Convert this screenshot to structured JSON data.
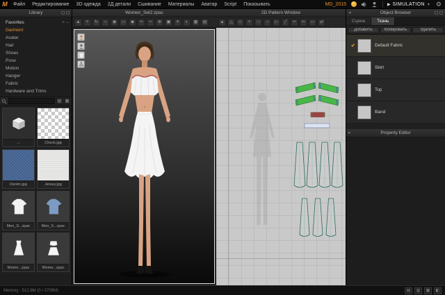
{
  "app": {
    "logo_letter": "M",
    "accent_color": "#e8912d"
  },
  "menubar": {
    "items": [
      "Файл",
      "Редактирование",
      "3D одежда",
      "2Д детали",
      "Сшивание",
      "Материалы",
      "Аватар",
      "Script",
      "Показывать"
    ],
    "version_label": "MD_2015",
    "simulation_label": "SIMULATION"
  },
  "icon_glyphs": {
    "select": "▲",
    "move": "+",
    "rotate": "↻",
    "zoom": "○",
    "show-avatar": "◉",
    "tape-measure": "▭",
    "pin": "◆",
    "sewing": "✂",
    "wind": "≈",
    "gizmo": "⊕",
    "camera": "▣",
    "light": "☀",
    "shadow": "◐",
    "texture": "▦",
    "grid": "▤",
    "transform": "▲",
    "edit-pattern": "△",
    "edit-curvature": "◇",
    "add-point": "+",
    "rectangle": "□",
    "circle": "○",
    "polygon": "▷",
    "internal-line": "╱",
    "free-sewing": "✄",
    "measure": "▭",
    "sync": "⇄"
  },
  "toolbar3d": {
    "icons": [
      "select",
      "move",
      "rotate",
      "zoom",
      "show-avatar",
      "tape-measure",
      "pin",
      "sewing",
      "wind",
      "gizmo",
      "camera",
      "light",
      "shadow",
      "texture",
      "grid"
    ]
  },
  "toolbar2d": {
    "icons": [
      "transform",
      "edit-pattern",
      "edit-curvature",
      "add-point",
      "rectangle",
      "circle",
      "polygon",
      "internal-line",
      "sewing",
      "free-sewing",
      "measure",
      "sync"
    ]
  },
  "library": {
    "title": "Library",
    "favorites_label": "Favorites",
    "categories": [
      "Garment",
      "Avatar",
      "Hair",
      "Shoes",
      "Pose",
      "Motion",
      "Hanger",
      "Fabric",
      "Hardware and Trims"
    ],
    "active_category": "Garment",
    "search_placeholder": "",
    "items": [
      {
        "label": "..."
      },
      {
        "label": "Check.jpg"
      },
      {
        "label": "Denim.jpg"
      },
      {
        "label": "Jersey.jpg"
      },
      {
        "label": "Men_S...zpac"
      },
      {
        "label": "Men_S...zpac"
      },
      {
        "label": "Wome...zpac"
      },
      {
        "label": "Wome...zpac"
      }
    ]
  },
  "viewport3d": {
    "title": "Women_Set2.zpac"
  },
  "viewport2d": {
    "title": "2D Pattern Window"
  },
  "object_browser": {
    "title": "Object Browser",
    "tabs": [
      "Сцена",
      "Ткань"
    ],
    "active_tab": "Ткань",
    "buttons": [
      "Добавить",
      "Копировать",
      "Удалить"
    ],
    "fabrics": [
      {
        "name": "Default Fabric",
        "checked": true
      },
      {
        "name": "Skirt",
        "checked": false
      },
      {
        "name": "Top",
        "checked": false
      },
      {
        "name": "Band",
        "checked": false
      }
    ]
  },
  "property_editor": {
    "title": "Property Editor"
  },
  "statusbar": {
    "left_text": "Memory : 512.8M (0 / 3708M)"
  }
}
